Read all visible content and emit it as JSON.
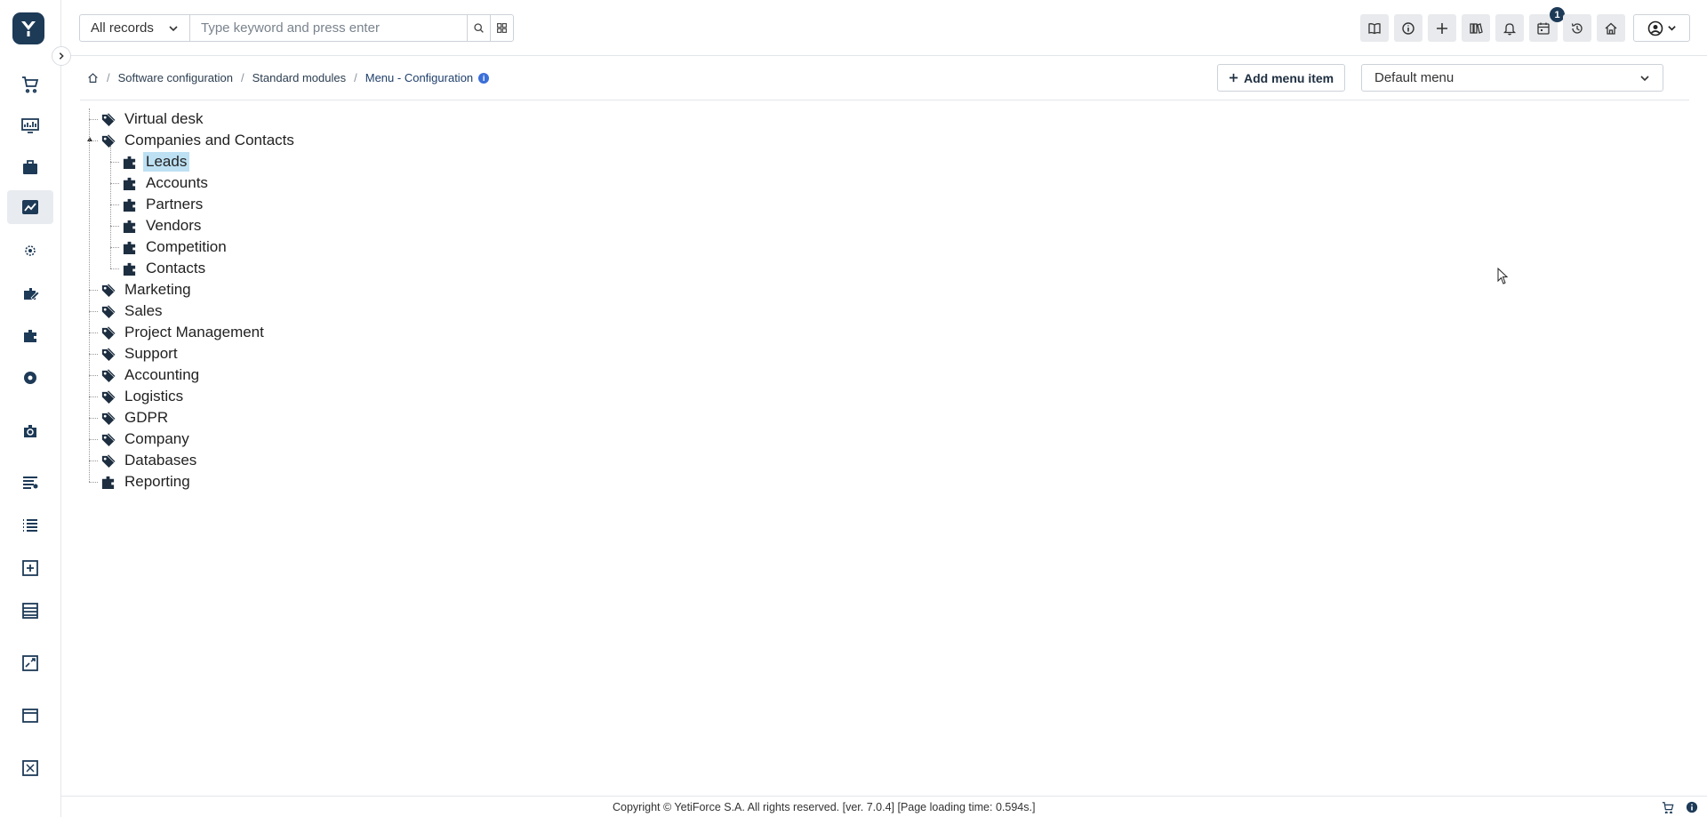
{
  "header": {
    "search_scope": "All records",
    "search_placeholder": "Type keyword and press enter",
    "calendar_badge": "1",
    "icons": [
      "book-icon",
      "info-icon",
      "plus-icon",
      "news-icon",
      "bell-icon",
      "calendar-icon",
      "history-icon",
      "home-icon"
    ]
  },
  "sidebar": {
    "icons": [
      "cart-icon",
      "monitor-chart-icon",
      "briefcase-icon",
      "settings-chart-icon",
      "users-gear-icon",
      "edit-module-icon",
      "puzzle-module-icon",
      "cog-module-icon",
      "search-module-icon",
      "list-settings-icon",
      "list-icon",
      "add-block-icon",
      "table-icon",
      "chart-box-icon",
      "window-icon",
      "field-icon"
    ],
    "active_index": 3
  },
  "breadcrumb": {
    "items": [
      "Software configuration",
      "Standard modules",
      "Menu - Configuration"
    ]
  },
  "toolbar": {
    "add_label": "Add menu item",
    "menu_select": "Default menu"
  },
  "tree": [
    {
      "label": "Virtual desk",
      "type": "tag",
      "level": 0
    },
    {
      "label": "Companies and Contacts",
      "type": "tag",
      "level": 0,
      "expanded": true
    },
    {
      "label": "Leads",
      "type": "module",
      "level": 1,
      "selected": true
    },
    {
      "label": "Accounts",
      "type": "module",
      "level": 1
    },
    {
      "label": "Partners",
      "type": "module",
      "level": 1
    },
    {
      "label": "Vendors",
      "type": "module",
      "level": 1
    },
    {
      "label": "Competition",
      "type": "module",
      "level": 1
    },
    {
      "label": "Contacts",
      "type": "module",
      "level": 1
    },
    {
      "label": "Marketing",
      "type": "tag",
      "level": 0
    },
    {
      "label": "Sales",
      "type": "tag",
      "level": 0
    },
    {
      "label": "Project Management",
      "type": "tag",
      "level": 0
    },
    {
      "label": "Support",
      "type": "tag",
      "level": 0
    },
    {
      "label": "Accounting",
      "type": "tag",
      "level": 0
    },
    {
      "label": "Logistics",
      "type": "tag",
      "level": 0
    },
    {
      "label": "GDPR",
      "type": "tag",
      "level": 0
    },
    {
      "label": "Company",
      "type": "tag",
      "level": 0
    },
    {
      "label": "Databases",
      "type": "tag",
      "level": 0
    },
    {
      "label": "Reporting",
      "type": "module",
      "level": 0
    }
  ],
  "footer": {
    "text": "Copyright © YetiForce S.A. All rights reserved. [ver. 7.0.4] [Page loading time: 0.594s.]"
  },
  "colors": {
    "brand": "#1d3a57",
    "selected_highlight": "#bde0f3",
    "info": "#3b6fd8"
  }
}
